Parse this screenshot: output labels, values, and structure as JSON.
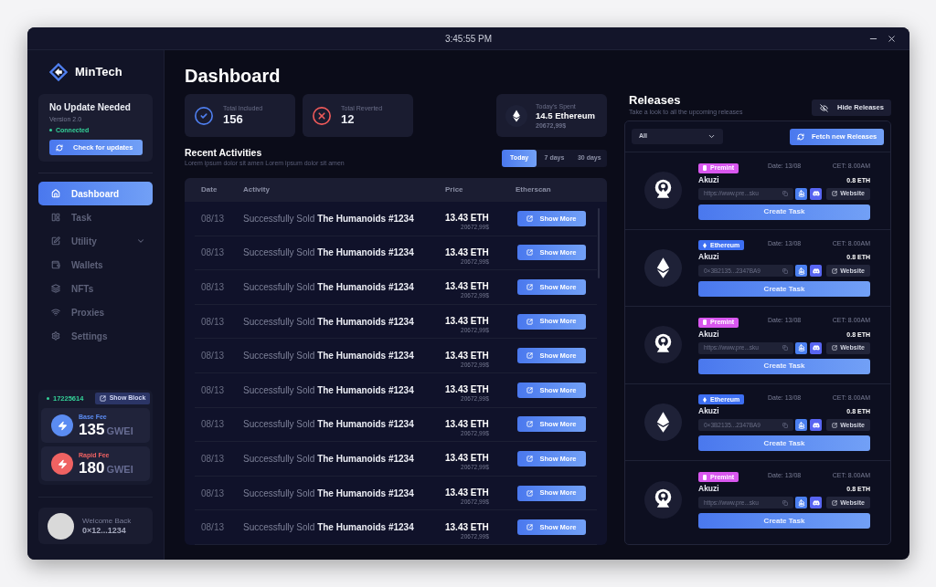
{
  "title_bar": {
    "clock": "3:45:55 PM"
  },
  "sidebar": {
    "brand": "MinTech",
    "update": {
      "title": "No Update Needed",
      "version": "Version 2.0",
      "status": "Connected",
      "button": "Check for updates"
    },
    "nav": [
      {
        "label": "Dashboard",
        "selected": true,
        "kind": "link"
      },
      {
        "label": "Task",
        "selected": false,
        "kind": "link"
      },
      {
        "label": "Utility",
        "selected": false,
        "kind": "group"
      },
      {
        "label": "Wallets",
        "selected": false,
        "kind": "link"
      },
      {
        "label": "NFTs",
        "selected": false,
        "kind": "link"
      },
      {
        "label": "Proxies",
        "selected": false,
        "kind": "link"
      },
      {
        "label": "Settings",
        "selected": false,
        "kind": "link"
      }
    ],
    "gas": {
      "block": "17225614",
      "button": "Show Block",
      "fees": [
        {
          "label": "Base Fee",
          "value": "135",
          "unit": "GWEI",
          "color": "#5b8cf2"
        },
        {
          "label": "Rapid Fee",
          "value": "180",
          "unit": "GWEI",
          "color": "#ef6262"
        }
      ]
    },
    "user": {
      "greeting": "Welcome Back",
      "address": "0×12...1234"
    }
  },
  "dashboard": {
    "title": "Dashboard",
    "stats": [
      {
        "label": "Total Included",
        "value": "156",
        "kind": "success"
      },
      {
        "label": "Total Reverted",
        "value": "12",
        "kind": "failure"
      }
    ],
    "spent": {
      "label": "Today's Spent",
      "value": "14.5 Ethereum",
      "fiat": "20672,99$"
    },
    "activities": {
      "title": "Recent Activities",
      "subtitle": "Lorem ipsum dolor sit amen Lorem ipsum dolor sit amen",
      "ranges": [
        {
          "label": "Today",
          "selected": true
        },
        {
          "label": "7 days",
          "selected": false
        },
        {
          "label": "30 days",
          "selected": false
        }
      ],
      "columns": [
        "Date",
        "Activity",
        "Price",
        "Etherscan"
      ],
      "rows": [
        {
          "date": "08/13",
          "activity": "Successfully Sold **The Humanoids #1234**",
          "price": "13.43 ETH",
          "fiat": "20672,99$",
          "action": "Show More"
        },
        {
          "date": "08/13",
          "activity": "Successfully Sold **The Humanoids #1234**",
          "price": "13.43 ETH",
          "fiat": "20672,99$",
          "action": "Show More"
        },
        {
          "date": "08/13",
          "activity": "Successfully Sold **The Humanoids #1234**",
          "price": "13.43 ETH",
          "fiat": "20672,99$",
          "action": "Show More"
        },
        {
          "date": "08/13",
          "activity": "Successfully Sold **The Humanoids #1234**",
          "price": "13.43 ETH",
          "fiat": "20672,99$",
          "action": "Show More"
        },
        {
          "date": "08/13",
          "activity": "Successfully Sold **The Humanoids #1234**",
          "price": "13.43 ETH",
          "fiat": "20672,99$",
          "action": "Show More"
        },
        {
          "date": "08/13",
          "activity": "Successfully Sold **The Humanoids #1234**",
          "price": "13.43 ETH",
          "fiat": "20672,99$",
          "action": "Show More"
        },
        {
          "date": "08/13",
          "activity": "Successfully Sold **The Humanoids #1234**",
          "price": "13.43 ETH",
          "fiat": "20672,99$",
          "action": "Show More"
        },
        {
          "date": "08/13",
          "activity": "Successfully Sold **The Humanoids #1234**",
          "price": "13.43 ETH",
          "fiat": "20672,99$",
          "action": "Show More"
        },
        {
          "date": "08/13",
          "activity": "Successfully Sold **The Humanoids #1234**",
          "price": "13.43 ETH",
          "fiat": "20672,99$",
          "action": "Show More"
        },
        {
          "date": "08/13",
          "activity": "Successfully Sold **The Humanoids #1234**",
          "price": "13.43 ETH",
          "fiat": "20672,99$",
          "action": "Show More"
        }
      ]
    }
  },
  "releases": {
    "title": "Releases",
    "subtitle": "Take a look to all the upcoming releases",
    "hide_button": "Hide Releases",
    "filter": "All",
    "fetch_button": "Fetch new Releases",
    "items": [
      {
        "kind": "premint",
        "tag": "Premint",
        "color": "#d957ef",
        "date": "Date: 13/08",
        "time": "CET: 8.00AM",
        "name": "Akuzi",
        "price": "0.8 ETH",
        "link": "https://www.pre...sku",
        "website": "Website",
        "button": "Create Task"
      },
      {
        "kind": "ethereum",
        "tag": "Ethereum",
        "color": "#3d6ff2",
        "date": "Date: 13/08",
        "time": "CET: 8.00AM",
        "name": "Akuzi",
        "price": "0.8 ETH",
        "link": "0×3B2135...2347BA9",
        "website": "Website",
        "button": "Create Task"
      },
      {
        "kind": "premint",
        "tag": "Premint",
        "color": "#d957ef",
        "date": "Date: 13/08",
        "time": "CET: 8.00AM",
        "name": "Akuzi",
        "price": "0.8 ETH",
        "link": "https://www.pre...sku",
        "website": "Website",
        "button": "Create Task"
      },
      {
        "kind": "ethereum",
        "tag": "Ethereum",
        "color": "#3d6ff2",
        "date": "Date: 13/08",
        "time": "CET: 8.00AM",
        "name": "Akuzi",
        "price": "0.8 ETH",
        "link": "0×3B2135...2347BA9",
        "website": "Website",
        "button": "Create Task"
      },
      {
        "kind": "premint",
        "tag": "Premint",
        "color": "#d957ef",
        "date": "Date: 13/08",
        "time": "CET: 8.00AM",
        "name": "Akuzi",
        "price": "0.8 ETH",
        "link": "https://www.pre...sku",
        "website": "Website",
        "button": "Create Task"
      }
    ]
  }
}
